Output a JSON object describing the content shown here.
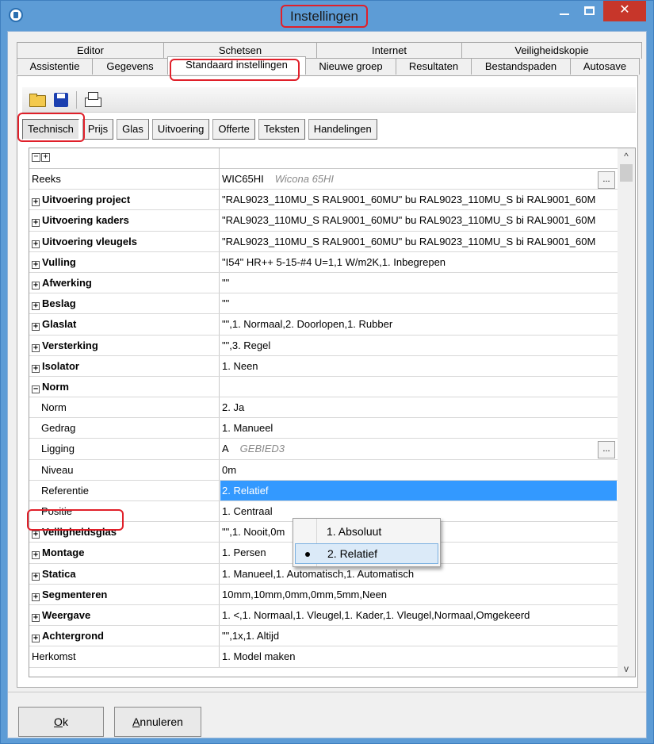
{
  "window": {
    "title": "Instellingen",
    "minimize": "—",
    "close": "✕"
  },
  "tabs": {
    "row1": [
      {
        "label": "Editor",
        "w": 186
      },
      {
        "label": "Schetsen",
        "w": 194
      },
      {
        "label": "Internet",
        "w": 184
      },
      {
        "label": "Veiligheidskopie",
        "w": 228
      }
    ],
    "row2": [
      {
        "label": "Assistentie",
        "w": 96,
        "selected": false
      },
      {
        "label": "Gegevens",
        "w": 96,
        "selected": false
      },
      {
        "label": "Standaard instellingen",
        "w": 175,
        "selected": true
      },
      {
        "label": "Nieuwe groep",
        "w": 115,
        "selected": false
      },
      {
        "label": "Resultaten",
        "w": 96,
        "selected": false
      },
      {
        "label": "Bestandspaden",
        "w": 126,
        "selected": false
      },
      {
        "label": "Autosave",
        "w": 88,
        "selected": false
      }
    ]
  },
  "toolbar": {
    "icons": [
      "folder-open-icon",
      "save-icon",
      "print-icon"
    ]
  },
  "subtabs": [
    {
      "label": "Technisch",
      "active": true
    },
    {
      "label": "Prijs",
      "active": false
    },
    {
      "label": "Glas",
      "active": false
    },
    {
      "label": "Uitvoering",
      "active": false
    },
    {
      "label": "Offerte",
      "active": false
    },
    {
      "label": "Teksten",
      "active": false
    },
    {
      "label": "Handelingen",
      "active": false
    }
  ],
  "grid": {
    "header": {
      "collapse_all": "−",
      "expand_all": "+"
    },
    "rows": [
      {
        "name": "Reeks",
        "value": "WIC65HI",
        "hint": "Wicona 65HI",
        "bold": false,
        "expander": "",
        "child": false,
        "ellipsis": true
      },
      {
        "name": "Uitvoering project",
        "value": "\"RAL9023_110MU_S RAL9001_60MU\" bu RAL9023_110MU_S bi RAL9001_60M",
        "bold": true,
        "expander": "+"
      },
      {
        "name": "Uitvoering kaders",
        "value": "\"RAL9023_110MU_S RAL9001_60MU\" bu RAL9023_110MU_S bi RAL9001_60M",
        "bold": true,
        "expander": "+"
      },
      {
        "name": "Uitvoering vleugels",
        "value": "\"RAL9023_110MU_S RAL9001_60MU\" bu RAL9023_110MU_S bi RAL9001_60M",
        "bold": true,
        "expander": "+"
      },
      {
        "name": "Vulling",
        "value": "\"I54\" HR++ 5-15-#4 U=1,1 W/m2K,1. Inbegrepen",
        "bold": true,
        "expander": "+"
      },
      {
        "name": "Afwerking",
        "value": "\"\"",
        "bold": true,
        "expander": "+"
      },
      {
        "name": "Beslag",
        "value": "\"\"",
        "bold": true,
        "expander": "+"
      },
      {
        "name": "Glaslat",
        "value": "\"\",1. Normaal,2. Doorlopen,1. Rubber",
        "bold": true,
        "expander": "+"
      },
      {
        "name": "Versterking",
        "value": "\"\",3. Regel",
        "bold": true,
        "expander": "+"
      },
      {
        "name": "Isolator",
        "value": "1. Neen",
        "bold": true,
        "expander": "+"
      },
      {
        "name": "Norm",
        "value": "",
        "bold": true,
        "expander": "−"
      },
      {
        "name": "Norm",
        "value": "2. Ja",
        "child": true
      },
      {
        "name": "Gedrag",
        "value": "1. Manueel",
        "child": true
      },
      {
        "name": "Ligging",
        "value": "A",
        "hint": "GEBIED3",
        "child": true,
        "ellipsis": true
      },
      {
        "name": "Niveau",
        "value": "0m",
        "child": true
      },
      {
        "name": "Referentie",
        "value": "2. Relatief",
        "child": true,
        "selected": true
      },
      {
        "name": "Positie",
        "value": "1. Centraal",
        "child": true
      },
      {
        "name": "Veiligheidsglas",
        "value": "\"\",1. Nooit,0m",
        "bold": true,
        "expander": "+"
      },
      {
        "name": "Montage",
        "value": "1. Persen",
        "bold": true,
        "expander": "+"
      },
      {
        "name": "Statica",
        "value": "1. Manueel,1. Automatisch,1. Automatisch",
        "bold": true,
        "expander": "+"
      },
      {
        "name": "Segmenteren",
        "value": "10mm,10mm,0mm,0mm,5mm,Neen",
        "bold": true,
        "expander": "+"
      },
      {
        "name": "Weergave",
        "value": "1. <,1. Normaal,1. Vleugel,1. Kader,1. Vleugel,Normaal,Omgekeerd",
        "bold": true,
        "expander": "+"
      },
      {
        "name": "Achtergrond",
        "value": "\"\",1x,1. Altijd",
        "bold": true,
        "expander": "+"
      },
      {
        "name": "Herkomst",
        "value": "1. Model maken",
        "bold": false,
        "expander": ""
      }
    ],
    "ellipsis_label": "...",
    "scroll_up": "^",
    "scroll_down": "v"
  },
  "dropdown": {
    "options": [
      "1. Absoluut",
      "2. Relatief"
    ],
    "selected_index": 1
  },
  "buttons": {
    "ok_mnemonic": "O",
    "ok_rest": "k",
    "cancel_mnemonic": "A",
    "cancel_rest": "nnuleren"
  },
  "colors": {
    "accent_red": "#e0202a",
    "selection_blue": "#3399ff",
    "title_bar": "#5d9cd6",
    "close_red": "#c7362a"
  }
}
